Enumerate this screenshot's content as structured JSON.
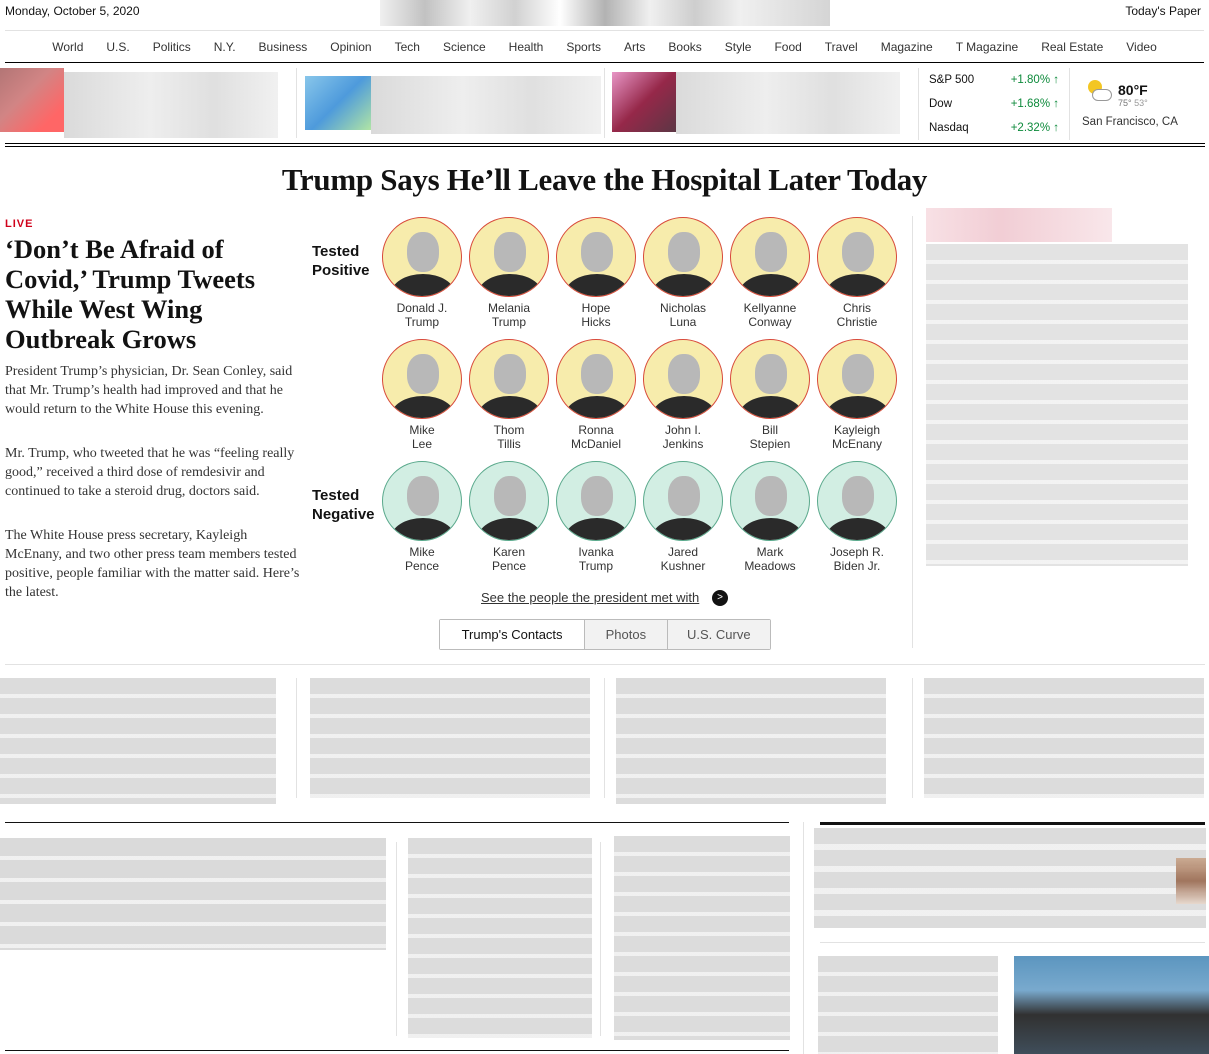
{
  "masthead": {
    "date": "Monday, October 5, 2020",
    "todays_paper": "Today's Paper"
  },
  "nav": [
    "World",
    "U.S.",
    "Politics",
    "N.Y.",
    "Business",
    "Opinion",
    "Tech",
    "Science",
    "Health",
    "Sports",
    "Arts",
    "Books",
    "Style",
    "Food",
    "Travel",
    "Magazine",
    "T Magazine",
    "Real Estate",
    "Video"
  ],
  "markets": [
    {
      "name": "S&P 500",
      "change": "+1.80% ↑"
    },
    {
      "name": "Dow",
      "change": "+1.68% ↑"
    },
    {
      "name": "Nasdaq",
      "change": "+2.32% ↑"
    }
  ],
  "weather": {
    "temp": "80°F",
    "high": "75°",
    "low": "53°",
    "location": "San Francisco, CA"
  },
  "main": {
    "headline": "Trump Says He’ll Leave the Hospital Later Today",
    "live": "LIVE",
    "lede_title": "‘Don’t Be Afraid of Covid,’ Trump Tweets While West Wing Outbreak Grows",
    "paragraphs": [
      "President Trump’s physician, Dr. Sean Conley, said that Mr. Trump’s health had improved and that he would return to the White House this evening.",
      "Mr. Trump, who tweeted that he was “feeling really good,” received a third dose of remdesivir and continued to take a steroid drug, doctors said.",
      "The White House press secretary, Kayleigh McEnany, and two other press team members tested positive, people familiar with the matter said. Here’s the latest."
    ]
  },
  "graphic": {
    "label_positive": "Tested Positive",
    "label_negative": "Tested Negative",
    "positive": [
      [
        "Donald J.",
        "Trump"
      ],
      [
        "Melania",
        "Trump"
      ],
      [
        "Hope",
        "Hicks"
      ],
      [
        "Nicholas",
        "Luna"
      ],
      [
        "Kellyanne",
        "Conway"
      ],
      [
        "Chris",
        "Christie"
      ],
      [
        "Mike",
        "Lee"
      ],
      [
        "Thom",
        "Tillis"
      ],
      [
        "Ronna",
        "McDaniel"
      ],
      [
        "John I.",
        "Jenkins"
      ],
      [
        "Bill",
        "Stepien"
      ],
      [
        "Kayleigh",
        "McEnany"
      ]
    ],
    "negative": [
      [
        "Mike",
        "Pence"
      ],
      [
        "Karen",
        "Pence"
      ],
      [
        "Ivanka",
        "Trump"
      ],
      [
        "Jared",
        "Kushner"
      ],
      [
        "Mark",
        "Meadows"
      ],
      [
        "Joseph R.",
        "Biden Jr."
      ]
    ],
    "see_link": "See the people the president met with",
    "arrow": ">",
    "tabs": [
      "Trump's Contacts",
      "Photos",
      "U.S. Curve"
    ]
  },
  "colors": {
    "positive_bg": "#f7ecac",
    "positive_border": "#d84a3a",
    "negative_bg": "#d2eee3",
    "negative_border": "#5aa98c",
    "live_red": "#d0021b",
    "market_green": "#0d8a3b"
  }
}
